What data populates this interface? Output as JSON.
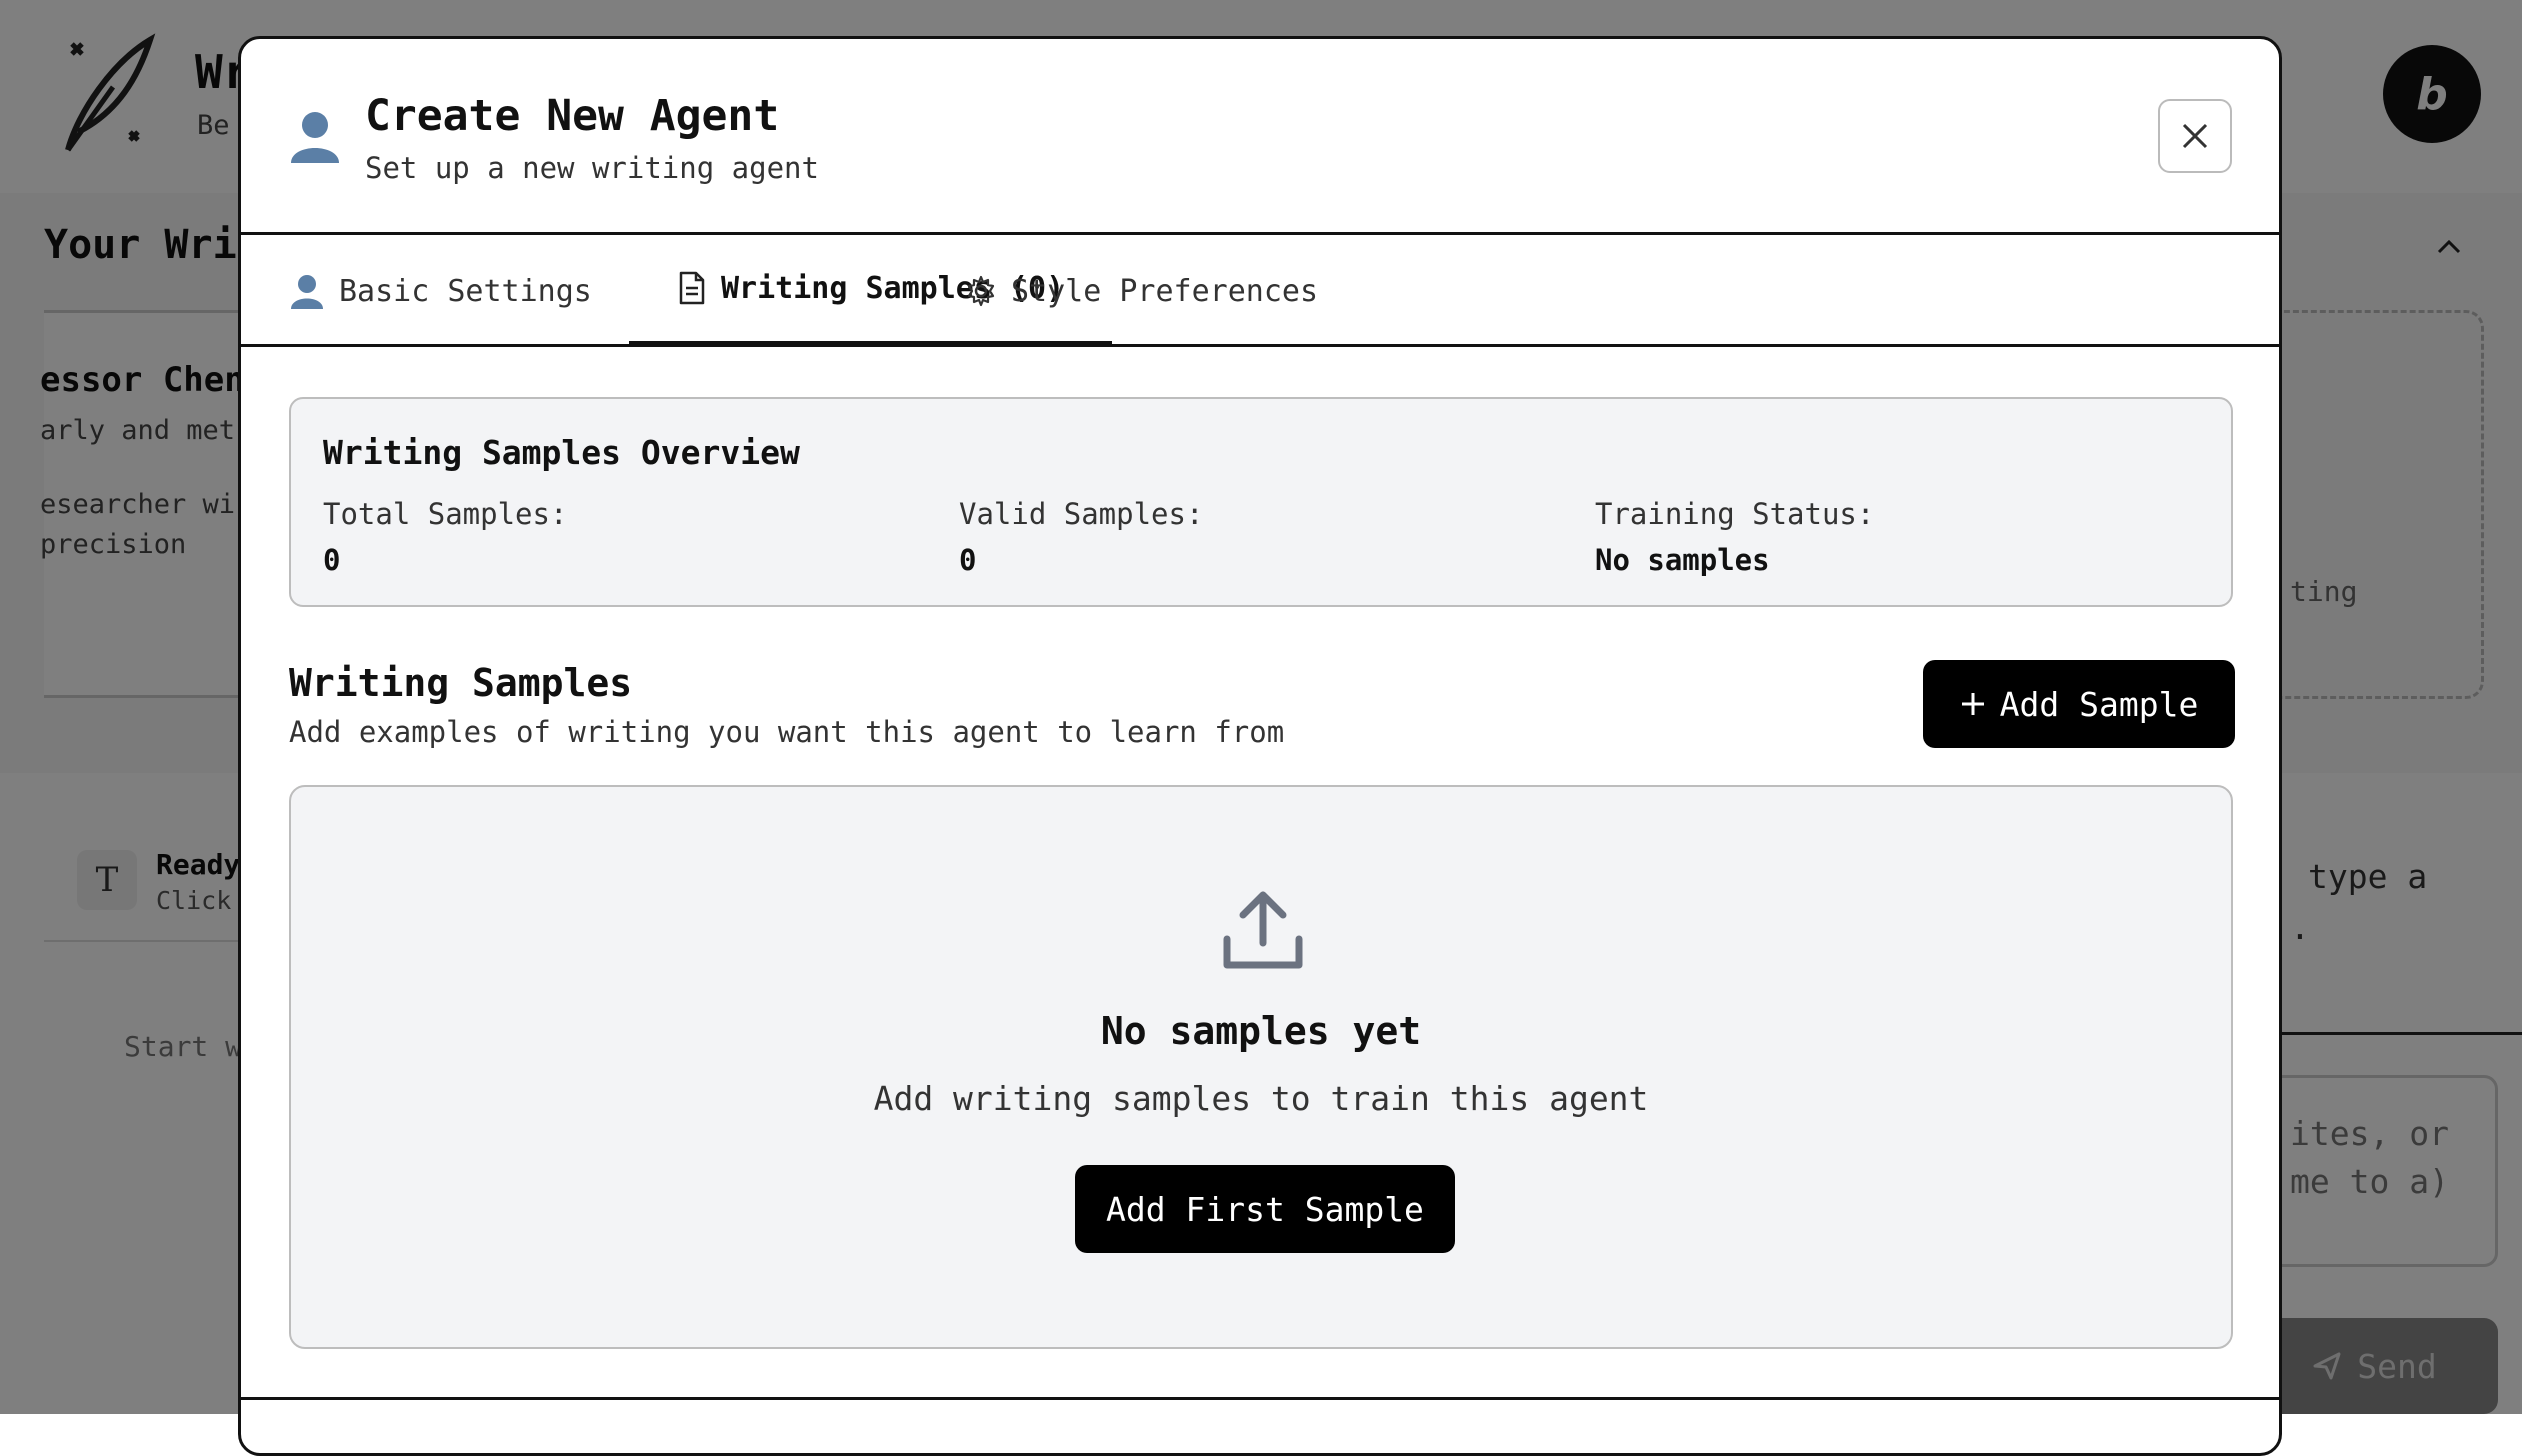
{
  "background": {
    "app_title": "Wr",
    "app_subtitle": "Be",
    "bolt_badge": "b",
    "section_title": "Your Wri",
    "card_name": "essor Chen",
    "card_line1": "arly and met",
    "card_line2": "esearcher wi precision",
    "dashed_text": "ting",
    "ready_title": "Ready",
    "ready_sub": "Click",
    "start_placeholder": "Start w",
    "type_hint_1": "type a",
    "type_hint_2": ".",
    "textarea_text": "ites, or me to a)",
    "send_label": "Send"
  },
  "modal": {
    "title": "Create New Agent",
    "subtitle": "Set up a new writing agent",
    "tabs": [
      {
        "label": "Basic Settings",
        "active": false
      },
      {
        "label": "Writing Samples (0)",
        "active": true
      },
      {
        "label": "Style Preferences",
        "active": false
      }
    ],
    "overview": {
      "title": "Writing Samples Overview",
      "total_label": "Total Samples:",
      "total_value": "0",
      "valid_label": "Valid Samples:",
      "valid_value": "0",
      "status_label": "Training Status:",
      "status_value": "No samples"
    },
    "samples": {
      "title": "Writing Samples",
      "subtitle": "Add examples of writing you want this agent to learn from",
      "add_button": "Add Sample",
      "empty_title": "No samples yet",
      "empty_subtitle": "Add writing samples to train this agent",
      "first_button": "Add First Sample"
    }
  },
  "colors": {
    "accent": "#000000",
    "panel_bg": "#f3f4f6",
    "overlay": "rgba(0,0,0,0.5)"
  }
}
